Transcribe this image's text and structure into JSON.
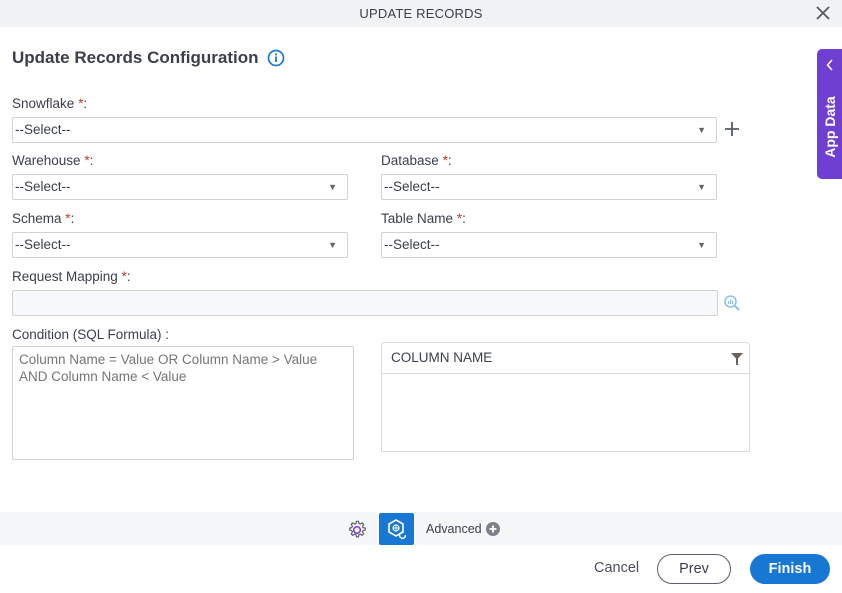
{
  "window": {
    "title": "UPDATE RECORDS",
    "close_icon": "close-icon"
  },
  "heading": {
    "title": "Update Records Configuration",
    "info_icon": "info-icon"
  },
  "colors": {
    "accent": "#1877d3",
    "app_data_tab": "#6f3fd1",
    "required": "#c0392b"
  },
  "fields": {
    "snowflake": {
      "label": "Snowflake",
      "required_mark": "*",
      "suffix": ":",
      "value": "--Select--"
    },
    "warehouse": {
      "label": "Warehouse",
      "required_mark": "*",
      "suffix": ":",
      "value": "--Select--"
    },
    "database": {
      "label": "Database",
      "required_mark": "*",
      "suffix": ":",
      "value": "--Select--"
    },
    "schema": {
      "label": "Schema",
      "required_mark": "*",
      "suffix": ":",
      "value": "--Select--"
    },
    "table_name": {
      "label": "Table Name",
      "required_mark": "*",
      "suffix": ":",
      "value": "--Select--"
    },
    "request_mapping": {
      "label": "Request Mapping",
      "required_mark": "*",
      "suffix": ":",
      "value": ""
    },
    "condition": {
      "label": "Condition (SQL Formula) :",
      "placeholder": "Column Name = Value OR Column Name > Value AND Column Name < Value",
      "value": ""
    }
  },
  "column_grid": {
    "header": "COLUMN NAME",
    "rows": []
  },
  "app_data": {
    "label": "App Data"
  },
  "toolbar": {
    "advanced_label": "Advanced"
  },
  "footer": {
    "cancel_label": "Cancel",
    "prev_label": "Prev",
    "finish_label": "Finish"
  }
}
